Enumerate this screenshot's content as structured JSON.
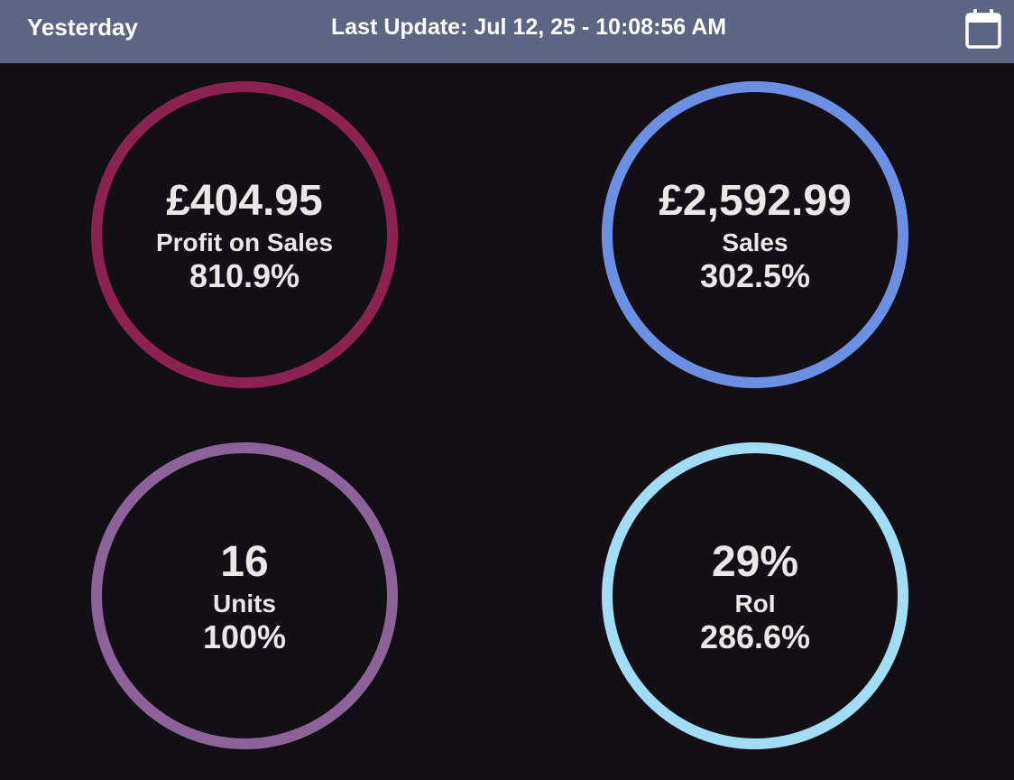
{
  "header": {
    "period_label": "Yesterday",
    "last_update": "Last Update: Jul 12, 25 - 10:08:56 AM",
    "calendar_icon": "calendar-icon",
    "background_color": "#5c6581"
  },
  "metrics": [
    {
      "value": "£404.95",
      "label": "Profit on Sales",
      "change": "810.9%",
      "ring_color": "#8c2251"
    },
    {
      "value": "£2,592.99",
      "label": "Sales",
      "change": "302.5%",
      "ring_color": "#6b8fe3"
    },
    {
      "value": "16",
      "label": "Units",
      "change": "100%",
      "ring_color": "#8c6399"
    },
    {
      "value": "29%",
      "label": "RoI",
      "change": "286.6%",
      "ring_color": "#a3dcf5"
    }
  ],
  "colors": {
    "page_background": "#121016",
    "text": "#ece6e6"
  }
}
